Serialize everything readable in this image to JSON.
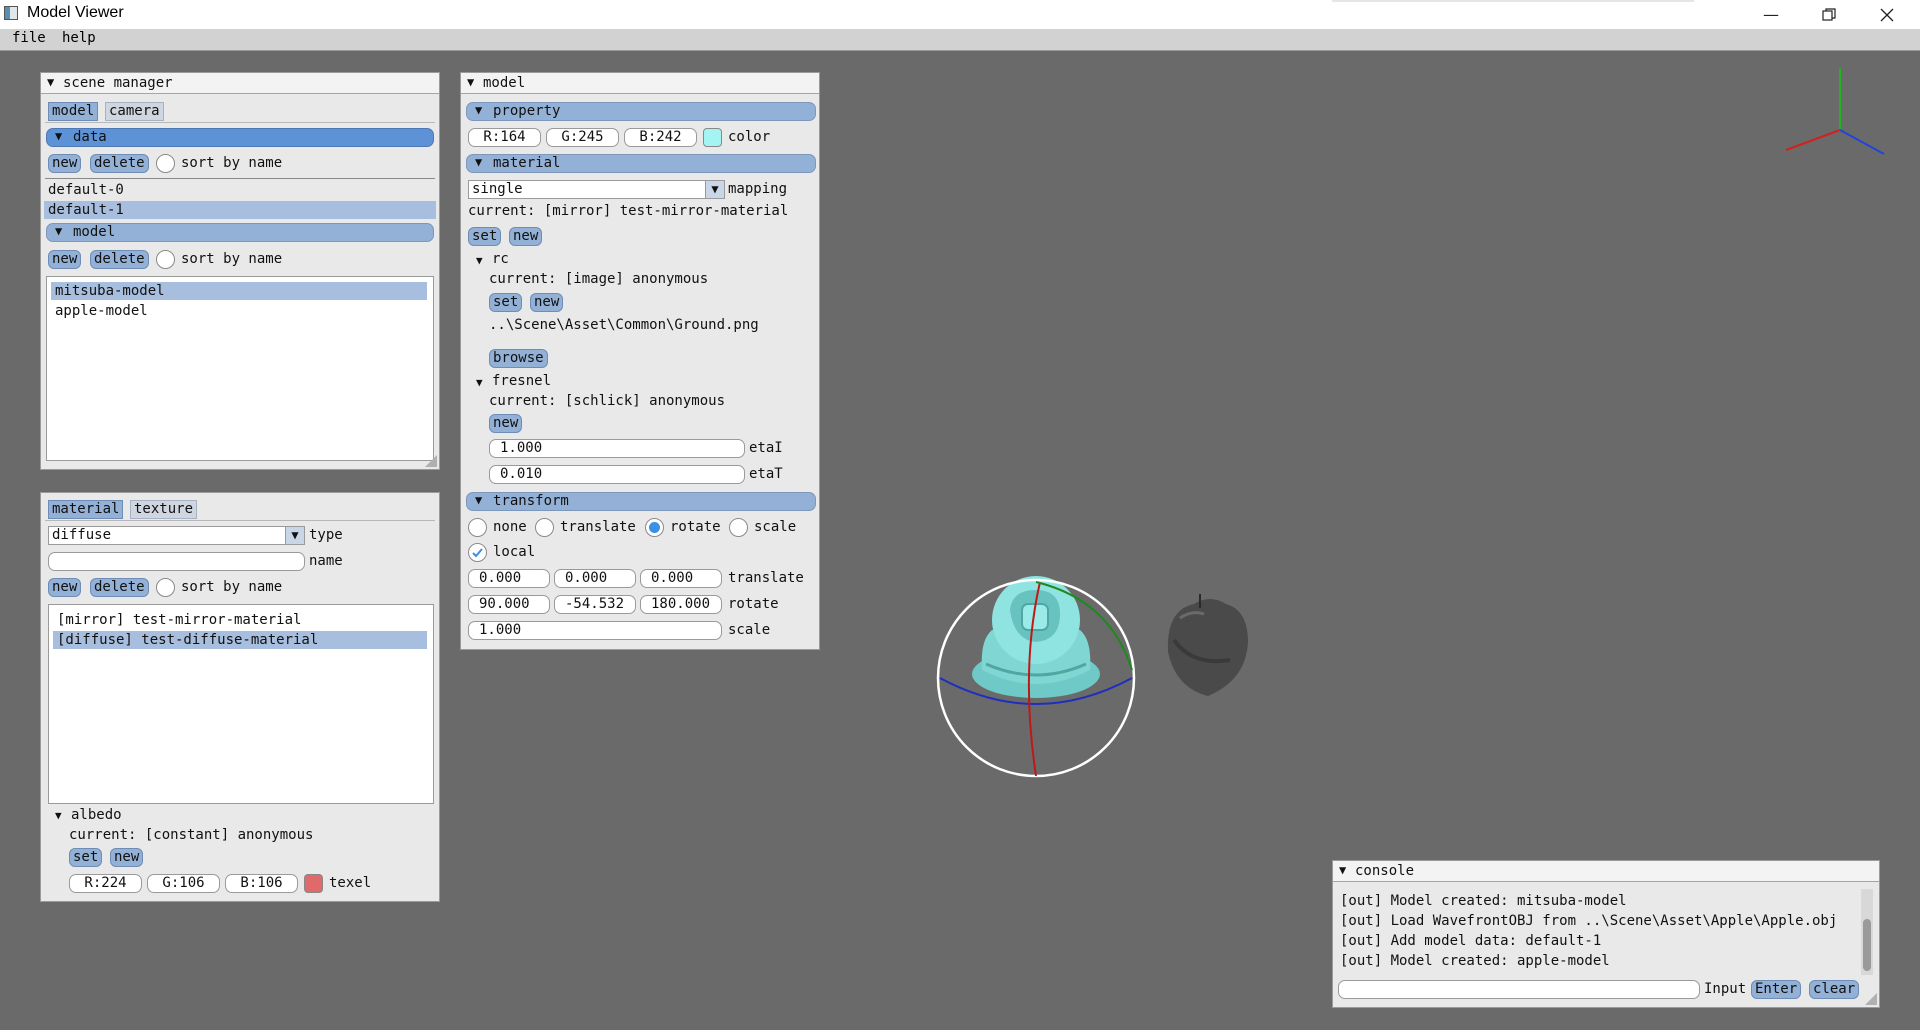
{
  "window": {
    "title": "Model Viewer"
  },
  "menu": {
    "items": [
      "file",
      "help"
    ]
  },
  "scene_manager": {
    "title": "scene manager",
    "tabs": [
      "model",
      "camera"
    ],
    "data_section": "data",
    "new_label": "new",
    "delete_label": "delete",
    "sort_label": "sort by name",
    "data_items": [
      "default-0",
      "default-1"
    ],
    "model_section": "model",
    "model_items": [
      "mitsuba-model",
      "apple-model"
    ]
  },
  "material_panel": {
    "tabs": [
      "material",
      "texture"
    ],
    "type_value": "diffuse",
    "type_label": "type",
    "name_value": "",
    "name_label": "name",
    "new_label": "new",
    "delete_label": "delete",
    "sort_label": "sort by name",
    "items": [
      "[mirror] test-mirror-material",
      "[diffuse] test-diffuse-material"
    ],
    "albedo": {
      "title": "albedo",
      "current": "current: [constant] anonymous",
      "set_label": "set",
      "new_label": "new",
      "r": "R:224",
      "g": "G:106",
      "b": "B:106",
      "texel_label": "texel",
      "color": "#e06a6a"
    }
  },
  "model_panel": {
    "title": "model",
    "property": {
      "title": "property",
      "r": "R:164",
      "g": "G:245",
      "b": "B:242",
      "color_label": "color",
      "color": "#a4f5f2"
    },
    "material": {
      "title": "material",
      "mapping_value": "single",
      "mapping_label": "mapping",
      "current": "current: [mirror] test-mirror-material",
      "set_label": "set",
      "new_label": "new",
      "rc": {
        "title": "rc",
        "current": "current: [image] anonymous",
        "set_label": "set",
        "new_label": "new",
        "path": "..\\Scene\\Asset\\Common\\Ground.png",
        "browse_label": "browse"
      },
      "fresnel": {
        "title": "fresnel",
        "current": "current: [schlick] anonymous",
        "new_label": "new",
        "etaI_value": "1.000",
        "etaI_label": "etaI",
        "etaT_value": "0.010",
        "etaT_label": "etaT"
      }
    },
    "transform": {
      "title": "transform",
      "modes": [
        "none",
        "translate",
        "rotate",
        "scale"
      ],
      "selected_mode": "rotate",
      "local_label": "local",
      "local_checked": true,
      "translate": [
        "0.000",
        "0.000",
        "0.000"
      ],
      "translate_label": "translate",
      "rotate": [
        "90.000",
        "-54.532",
        "180.000"
      ],
      "rotate_label": "rotate",
      "scale": "1.000",
      "scale_label": "scale"
    }
  },
  "console": {
    "title": "console",
    "lines": [
      "[out] Model created: mitsuba-model",
      "[out] Load WavefrontOBJ from ..\\Scene\\Asset\\Apple\\Apple.obj",
      "[out] Add model data: default-1",
      "[out] Model created: apple-model"
    ],
    "input_value": "",
    "input_label": "Input",
    "enter_label": "Enter",
    "clear_label": "clear"
  }
}
